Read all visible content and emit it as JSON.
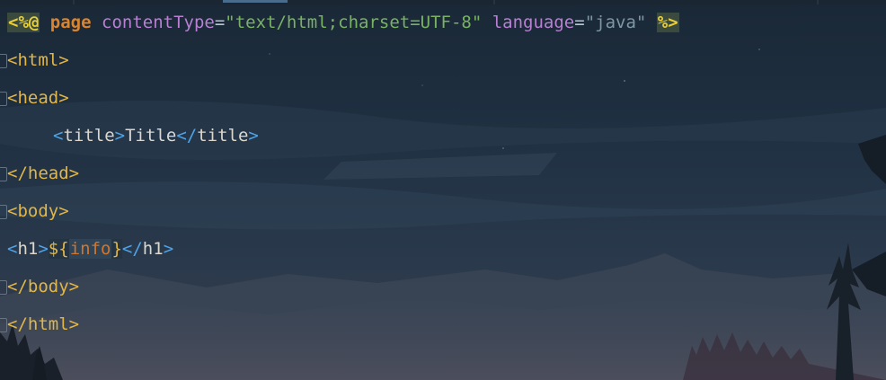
{
  "directive": {
    "open": "<%@",
    "keyword": "page",
    "attr1_name": "contentType",
    "eq": "=",
    "attr1_value": "\"text/html;charset=UTF-8\"",
    "attr2_name": "language",
    "attr2_value": "\"java\"",
    "close": "%>"
  },
  "lines": {
    "html_open": {
      "lt": "<",
      "name": "html",
      "gt": ">"
    },
    "head_open": {
      "lt": "<",
      "name": "head",
      "gt": ">"
    },
    "title": {
      "lt": "<",
      "name": "title",
      "gt": ">",
      "text": "Title",
      "close_lt": "</",
      "close_name": "title",
      "close_gt": ">"
    },
    "head_close": {
      "lt": "</",
      "name": "head",
      "gt": ">"
    },
    "body_open": {
      "lt": "<",
      "name": "body",
      "gt": ">"
    },
    "h1": {
      "lt": "<",
      "name": "h1",
      "gt": ">",
      "el_open": "${",
      "el_var": "info",
      "el_close": "}",
      "close_lt": "</",
      "close_name": "h1",
      "close_gt": ">"
    },
    "body_close": {
      "lt": "</",
      "name": "body",
      "gt": ">"
    },
    "html_close": {
      "lt": "</",
      "name": "html",
      "gt": ">"
    }
  }
}
